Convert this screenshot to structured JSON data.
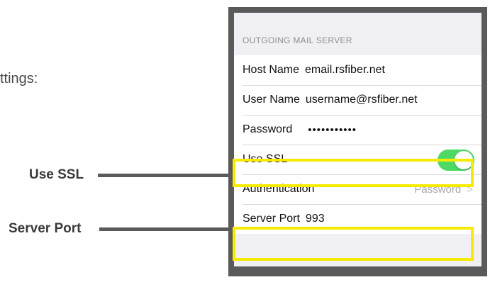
{
  "intro": {
    "text": "ttings:"
  },
  "callouts": {
    "use_ssl": "Use SSL",
    "server_port": "Server Port"
  },
  "screen": {
    "section_header": "OUTGOING MAIL SERVER",
    "rows": {
      "host_name": {
        "label": "Host Name",
        "value": "email.rsfiber.net"
      },
      "user_name": {
        "label": "User Name",
        "value": "username@rsfiber.net"
      },
      "password": {
        "label": "Password",
        "value": "•••••••••••"
      },
      "use_ssl": {
        "label": "Use SSL",
        "toggle_on": true
      },
      "authentication": {
        "label": "Authentication",
        "value": "Password",
        "icon": "chevron-right-icon"
      },
      "server_port": {
        "label": "Server Port",
        "value": "993"
      }
    }
  },
  "colors": {
    "highlight": "#f5ea00",
    "toggle_on": "#4cd964",
    "frame": "#5a5a5a",
    "callout_line": "#5a5a5a"
  }
}
